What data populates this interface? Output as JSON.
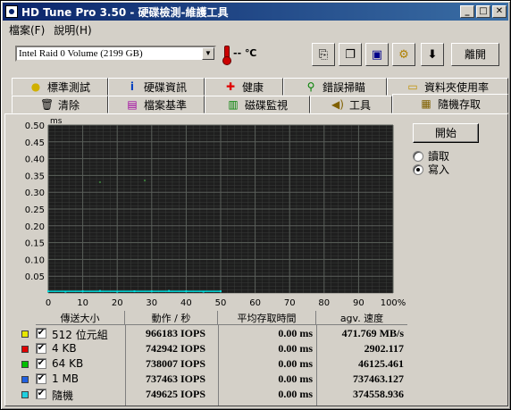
{
  "window": {
    "title": "HD Tune Pro 3.50 - 硬碟檢測-維護工具"
  },
  "menu": [
    {
      "label": "檔案(F)"
    },
    {
      "label": "說明(H)"
    }
  ],
  "toolbar": {
    "drive": "Intel  Raid 0 Volume (2199 GB)",
    "temperature": "-- ℃",
    "exit_label": "離開",
    "icons": [
      "copy-icon",
      "copy-screenshot-icon",
      "save-icon",
      "settings-icon",
      "download-icon"
    ]
  },
  "tabs_top": [
    {
      "label": "標準測試",
      "icon": "info-bulb-icon"
    },
    {
      "label": "硬碟資訊",
      "icon": "info-icon"
    },
    {
      "label": "健康",
      "icon": "health-cross-icon"
    },
    {
      "label": "錯誤掃瞄",
      "icon": "magnifier-icon"
    },
    {
      "label": "資料夾使用率",
      "icon": "folder-icon"
    }
  ],
  "tabs_bottom": [
    {
      "label": "清除",
      "icon": "trash-icon"
    },
    {
      "label": "檔案基準",
      "icon": "file-benchmark-icon"
    },
    {
      "label": "磁碟監視",
      "icon": "monitor-icon"
    },
    {
      "label": "工具",
      "icon": "speaker-icon"
    },
    {
      "label": "隨機存取",
      "icon": "random-access-icon"
    }
  ],
  "controls": {
    "start_label": "開始",
    "read_label": "讀取",
    "write_label": "寫入",
    "mode_selected": "write"
  },
  "chart_data": {
    "type": "scatter",
    "ylabel": "ms",
    "y_ticks": [
      "0.50",
      "0.45",
      "0.40",
      "0.35",
      "0.30",
      "0.25",
      "0.20",
      "0.15",
      "0.10",
      "0.05"
    ],
    "x_ticks": [
      "0",
      "10",
      "20",
      "30",
      "40",
      "50",
      "60",
      "70",
      "80",
      "90",
      "100%"
    ],
    "xlim": [
      0,
      100
    ],
    "ylim": [
      0,
      0.5
    ],
    "grid": true,
    "background": "#1e1e1e",
    "grid_color": "#5a5f5a",
    "series": [
      {
        "color": "#00e0e0",
        "points": [
          [
            0,
            0.005
          ],
          [
            5,
            0.004
          ],
          [
            10,
            0.005
          ],
          [
            15,
            0.006
          ],
          [
            20,
            0.004
          ],
          [
            25,
            0.005
          ],
          [
            30,
            0.005
          ],
          [
            35,
            0.006
          ],
          [
            40,
            0.005
          ],
          [
            45,
            0.004
          ],
          [
            50,
            0.005
          ]
        ]
      },
      {
        "color": "#3a7a3a",
        "points": [
          [
            15,
            0.33
          ],
          [
            28,
            0.335
          ]
        ]
      }
    ]
  },
  "results": {
    "headers": {
      "size": "傳送大小",
      "ops": "動作 / 秒",
      "access": "平均存取時間",
      "speed": "agv. 速度"
    },
    "rows": [
      {
        "color": "#e8e800",
        "checked": "✔",
        "size": "512 位元組",
        "iops": "966183 IOPS",
        "access": "0.00 ms",
        "speed": "471.769 MB/s"
      },
      {
        "color": "#e00000",
        "checked": "✔",
        "size": "4 KB",
        "iops": "742942 IOPS",
        "access": "0.00 ms",
        "speed": "2902.117"
      },
      {
        "color": "#00c000",
        "checked": "✔",
        "size": "64 KB",
        "iops": "738007 IOPS",
        "access": "0.00 ms",
        "speed": "46125.461"
      },
      {
        "color": "#2060e0",
        "checked": "✔",
        "size": "1 MB",
        "iops": "737463 IOPS",
        "access": "0.00 ms",
        "speed": "737463.127"
      },
      {
        "color": "#20d0e0",
        "checked": "✔",
        "size": "隨機",
        "iops": "749625 IOPS",
        "access": "0.00 ms",
        "speed": "374558.936"
      }
    ]
  }
}
